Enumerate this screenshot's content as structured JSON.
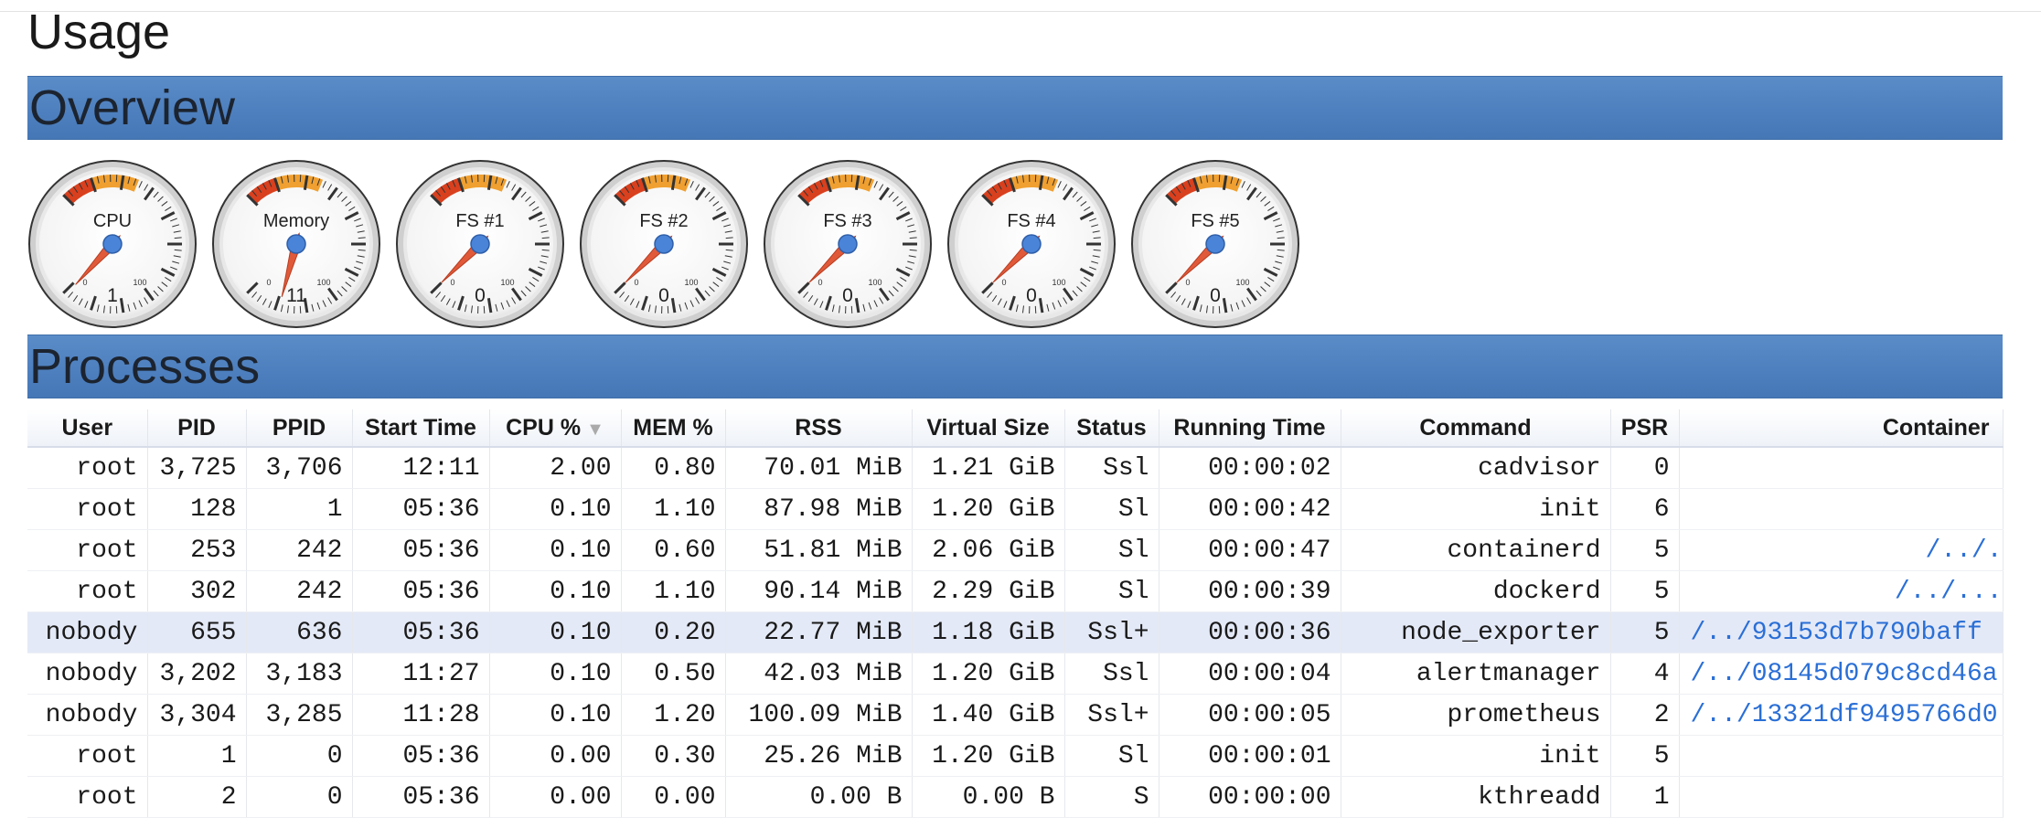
{
  "page_title": "Usage",
  "sections": {
    "overview": "Overview",
    "processes": "Processes"
  },
  "gauges": [
    {
      "label": "CPU",
      "value": "1",
      "percent": 1
    },
    {
      "label": "Memory",
      "value": "11",
      "percent": 11
    },
    {
      "label": "FS #1",
      "value": "0",
      "percent": 0
    },
    {
      "label": "FS #2",
      "value": "0",
      "percent": 0
    },
    {
      "label": "FS #3",
      "value": "0",
      "percent": 0
    },
    {
      "label": "FS #4",
      "value": "0",
      "percent": 0
    },
    {
      "label": "FS #5",
      "value": "0",
      "percent": 0
    }
  ],
  "gauge_scale": {
    "min_label": "0",
    "max_label": "100"
  },
  "colors": {
    "section_bar": "#4e80bf",
    "needle": "#e05a3a",
    "hub": "#4a84d8",
    "zone_yellow": "#f0a030",
    "zone_red": "#d9401e",
    "link": "#2a6fd6",
    "highlight_row": "#e4e9f7"
  },
  "table": {
    "headers": [
      "User",
      "PID",
      "PPID",
      "Start Time",
      "CPU %",
      "MEM %",
      "RSS",
      "Virtual Size",
      "Status",
      "Running Time",
      "Command",
      "PSR",
      "Container"
    ],
    "sort_indicator": "▼",
    "rows": [
      {
        "cells": [
          "root",
          "3,725",
          "3,706",
          "12:11",
          "2.00",
          "0.80",
          "70.01 MiB",
          "1.21 GiB",
          "Ssl",
          "00:00:02",
          "cadvisor",
          "0",
          ""
        ],
        "highlight": false
      },
      {
        "cells": [
          "root",
          "128",
          "1",
          "05:36",
          "0.10",
          "1.10",
          "87.98 MiB",
          "1.20 GiB",
          "Sl",
          "00:00:42",
          "init",
          "6",
          ""
        ],
        "highlight": false
      },
      {
        "cells": [
          "root",
          "253",
          "242",
          "05:36",
          "0.10",
          "0.60",
          "51.81 MiB",
          "2.06 GiB",
          "Sl",
          "00:00:47",
          "containerd",
          "5",
          "/../."
        ],
        "highlight": false
      },
      {
        "cells": [
          "root",
          "302",
          "242",
          "05:36",
          "0.10",
          "1.10",
          "90.14 MiB",
          "2.29 GiB",
          "Sl",
          "00:00:39",
          "dockerd",
          "5",
          "/../..."
        ],
        "highlight": false
      },
      {
        "cells": [
          "nobody",
          "655",
          "636",
          "05:36",
          "0.10",
          "0.20",
          "22.77 MiB",
          "1.18 GiB",
          "Ssl+",
          "00:00:36",
          "node_exporter",
          "5",
          "/../93153d7b790baff"
        ],
        "highlight": true
      },
      {
        "cells": [
          "nobody",
          "3,202",
          "3,183",
          "11:27",
          "0.10",
          "0.50",
          "42.03 MiB",
          "1.20 GiB",
          "Ssl",
          "00:00:04",
          "alertmanager",
          "4",
          "/../08145d079c8cd46a"
        ],
        "highlight": false
      },
      {
        "cells": [
          "nobody",
          "3,304",
          "3,285",
          "11:28",
          "0.10",
          "1.20",
          "100.09 MiB",
          "1.40 GiB",
          "Ssl+",
          "00:00:05",
          "prometheus",
          "2",
          "/../13321df9495766d0"
        ],
        "highlight": false
      },
      {
        "cells": [
          "root",
          "1",
          "0",
          "05:36",
          "0.00",
          "0.30",
          "25.26 MiB",
          "1.20 GiB",
          "Sl",
          "00:00:01",
          "init",
          "5",
          ""
        ],
        "highlight": false
      },
      {
        "cells": [
          "root",
          "2",
          "0",
          "05:36",
          "0.00",
          "0.00",
          "0.00 B",
          "0.00 B",
          "S",
          "00:00:00",
          "kthreadd",
          "1",
          ""
        ],
        "highlight": false
      }
    ]
  }
}
